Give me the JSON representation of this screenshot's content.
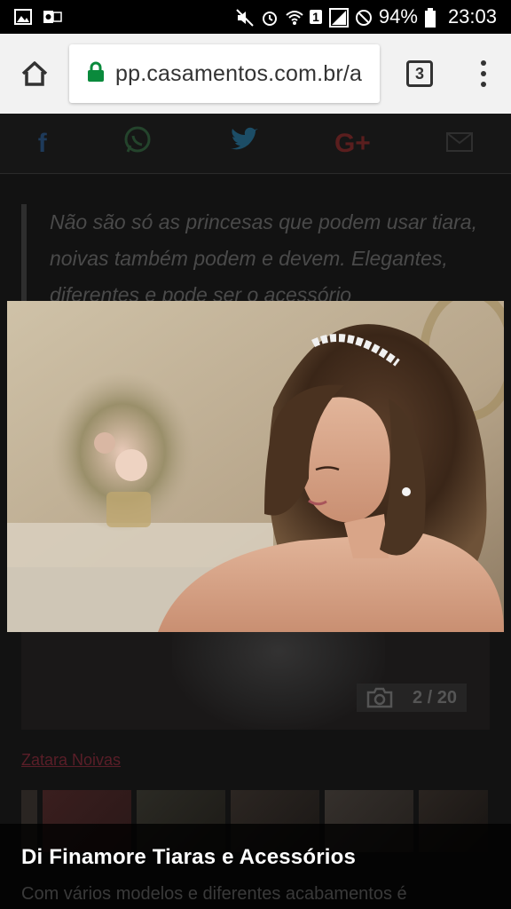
{
  "status_bar": {
    "battery": "94%",
    "time": "23:03",
    "sim": "1"
  },
  "browser": {
    "url": "pp.casamentos.com.br/a",
    "tab_count": "3"
  },
  "share": {
    "colors": {
      "facebook": "#1e3a5a",
      "whatsapp": "#24442c",
      "twitter": "#1c4d66",
      "googleplus": "#5a1e1e",
      "email": "#2f2f2f"
    }
  },
  "article": {
    "quote": "Não são só as princesas que podem usar tiara, noivas também podem e devem. Elegantes, diferentes e pode ser o acessório",
    "photo_counter": "2 / 20",
    "author_link": "Zatara Noivas"
  },
  "caption": {
    "title": "Di Finamore Tiaras e Acessórios",
    "text": "Com vários modelos e diferentes acabamentos é"
  }
}
